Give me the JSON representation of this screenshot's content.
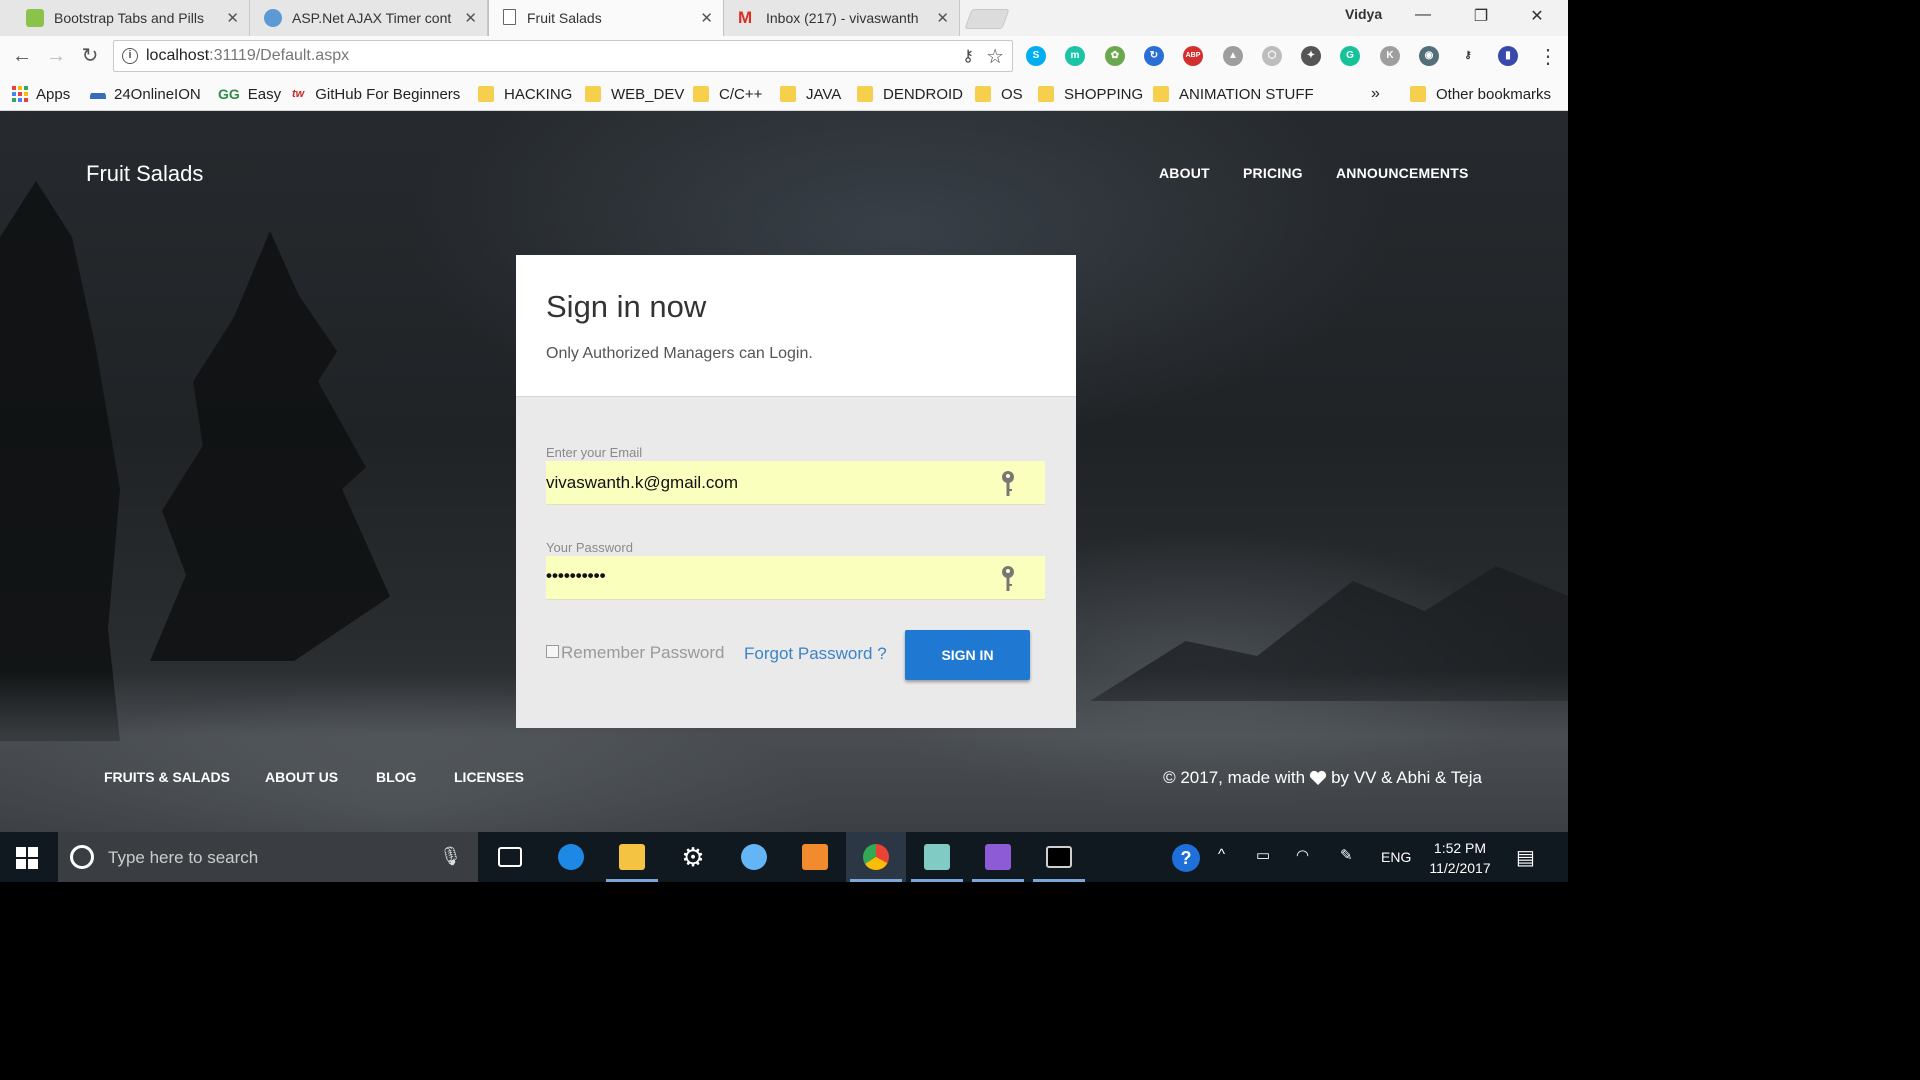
{
  "browser": {
    "tabs": [
      {
        "title": "Bootstrap Tabs and Pills",
        "active": false
      },
      {
        "title": "ASP.Net AJAX Timer cont",
        "active": false
      },
      {
        "title": "Fruit Salads",
        "active": true
      },
      {
        "title": "Inbox (217) - vivaswanth",
        "active": false
      }
    ],
    "profile_name": "Vidya",
    "url_host": "localhost",
    "url_rest": ":31119/Default.aspx",
    "bookmarks": [
      {
        "label": "Apps",
        "icon": "apps-grid-icon"
      },
      {
        "label": "24OnlineION",
        "icon": "cloud-icon"
      },
      {
        "label": "Easy",
        "icon": "geeksforgeeks-icon"
      },
      {
        "label": "GitHub For Beginners",
        "icon": "tw-icon"
      },
      {
        "label": "HACKING",
        "icon": "folder-icon"
      },
      {
        "label": "WEB_DEV",
        "icon": "folder-icon"
      },
      {
        "label": "C/C++",
        "icon": "folder-icon"
      },
      {
        "label": "JAVA",
        "icon": "folder-icon"
      },
      {
        "label": "DENDROID",
        "icon": "folder-icon"
      },
      {
        "label": "OS",
        "icon": "folder-icon"
      },
      {
        "label": "SHOPPING",
        "icon": "folder-icon"
      },
      {
        "label": "ANIMATION STUFF",
        "icon": "folder-icon"
      }
    ],
    "bookmarks_overflow": "»",
    "other_bookmarks": "Other bookmarks",
    "extensions": [
      {
        "name": "skype-icon",
        "color": "#00aff0",
        "glyph": "S"
      },
      {
        "name": "mendeley-icon",
        "color": "#1bc3a7",
        "glyph": "m"
      },
      {
        "name": "extension-green-icon",
        "color": "#6aa84f",
        "glyph": "✿"
      },
      {
        "name": "sync-icon",
        "color": "#2b6fd6",
        "glyph": "↻"
      },
      {
        "name": "adblock-plus-icon",
        "color": "#d32f2f",
        "glyph": "ABP"
      },
      {
        "name": "google-drive-icon",
        "color": "#9e9e9e",
        "glyph": "▲"
      },
      {
        "name": "cube-icon",
        "color": "#bdbdbd",
        "glyph": "⬡"
      },
      {
        "name": "compass-icon",
        "color": "#555555",
        "glyph": "✦"
      },
      {
        "name": "grammarly-icon",
        "color": "#15c39a",
        "glyph": "G"
      },
      {
        "name": "k-extension-icon",
        "color": "#9e9e9e",
        "glyph": "K"
      },
      {
        "name": "eye-extension-icon",
        "color": "#546e7a",
        "glyph": "◉"
      },
      {
        "name": "key-extension-icon",
        "color": "#fafafa",
        "glyph": "⚷"
      },
      {
        "name": "flag-extension-icon",
        "color": "#3949ab",
        "glyph": "▮"
      }
    ]
  },
  "site": {
    "brand": "Fruit Salads",
    "nav": [
      "ABOUT",
      "PRICING",
      "ANNOUNCEMENTS"
    ]
  },
  "login": {
    "title": "Sign in now",
    "subtitle": "Only Authorized Managers can Login.",
    "email_label": "Enter your Email",
    "email_value": "vivaswanth.k@gmail.com",
    "password_label": "Your Password",
    "password_value": "••••••••••",
    "remember_label": "Remember Password",
    "remember_checked": false,
    "forgot_label": "Forgot Password ?",
    "signin_label": "SIGN IN"
  },
  "footer": {
    "links": [
      "FRUITS & SALADS",
      "ABOUT US",
      "BLOG",
      "LICENSES"
    ],
    "copyright_before": "© 2017, made with",
    "copyright_after": "by VV & Abhi & Teja"
  },
  "taskbar": {
    "search_placeholder": "Type here to search",
    "apps": [
      {
        "name": "task-view-icon",
        "color": "#ffffff"
      },
      {
        "name": "edge-icon",
        "color": "#1e88e5"
      },
      {
        "name": "file-explorer-icon",
        "color": "#f5c342"
      },
      {
        "name": "settings-gear-icon",
        "color": "#ffffff"
      },
      {
        "name": "cloud-upload-icon",
        "color": "#64b5f6"
      },
      {
        "name": "sublime-text-icon",
        "color": "#f28b2e"
      },
      {
        "name": "chrome-icon",
        "color": "#4caf50"
      },
      {
        "name": "notepad-icon",
        "color": "#80cbc4"
      },
      {
        "name": "visual-studio-icon",
        "color": "#8e5bd6"
      },
      {
        "name": "command-prompt-icon",
        "color": "#cfcfcf"
      }
    ],
    "language": "ENG",
    "time": "1:52 PM",
    "date": "11/2/2017"
  }
}
